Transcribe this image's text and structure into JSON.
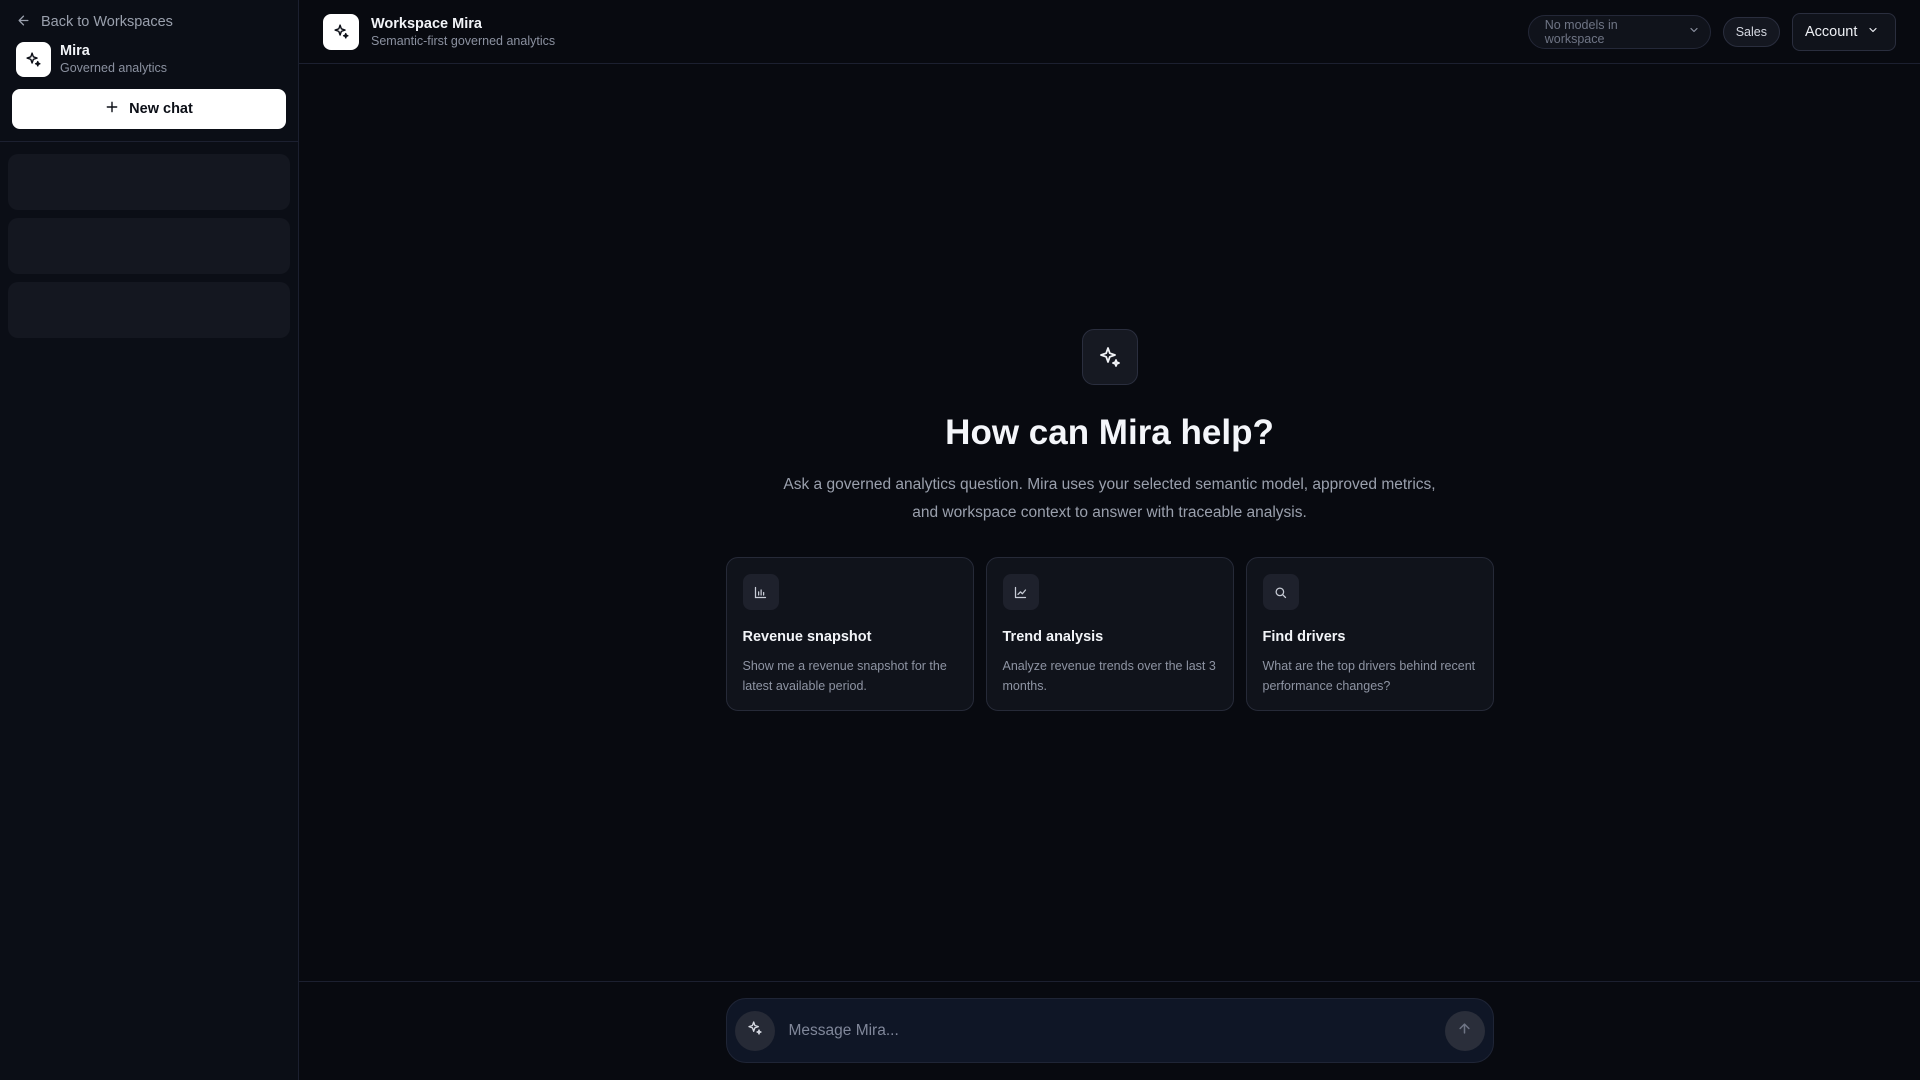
{
  "sidebar": {
    "back_label": "Back to Workspaces",
    "brand_name": "Mira",
    "brand_sub": "Governed analytics",
    "new_chat_label": "New chat",
    "skeleton_count": 3
  },
  "header": {
    "workspace_title": "Workspace Mira",
    "workspace_sub": "Semantic-first governed analytics",
    "model_select_value": "No models in workspace",
    "domain_pill": "Sales",
    "account_label": "Account"
  },
  "hero": {
    "title": "How can Mira help?",
    "description": "Ask a governed analytics question. Mira uses your selected semantic model, approved metrics, and workspace context to answer with traceable analysis."
  },
  "suggestions": [
    {
      "icon": "bar-chart-icon",
      "title": "Revenue snapshot",
      "description": "Show me a revenue snapshot for the latest available period."
    },
    {
      "icon": "line-chart-icon",
      "title": "Trend analysis",
      "description": "Analyze revenue trends over the last 3 months."
    },
    {
      "icon": "search-icon",
      "title": "Find drivers",
      "description": "What are the top drivers behind recent performance changes?"
    }
  ],
  "composer": {
    "placeholder": "Message Mira..."
  },
  "colors": {
    "background": "#080a10",
    "sidebar": "#0b0e16",
    "accent_white": "#ffffff",
    "composer": "#0f1626"
  }
}
